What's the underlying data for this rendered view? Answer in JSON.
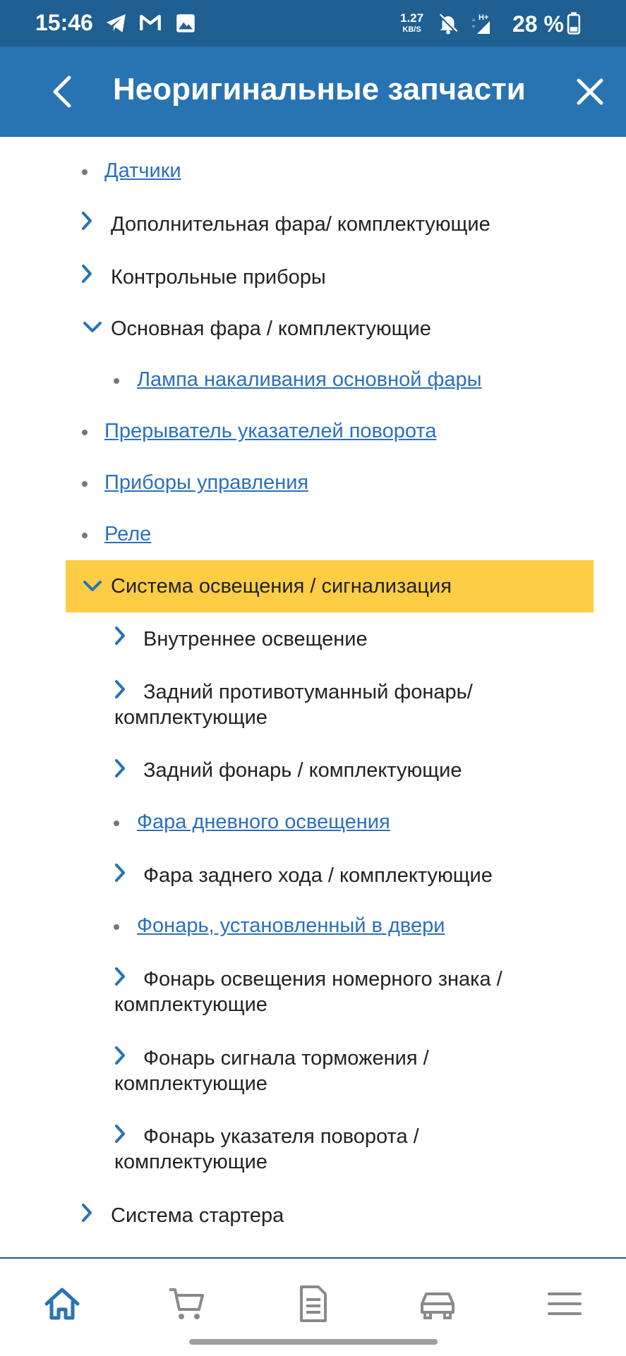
{
  "status_bar": {
    "time": "15:46",
    "net_speed": "1.27",
    "net_unit": "KB/S",
    "network": "H+",
    "battery": "28 %",
    "icons": [
      "telegram-icon",
      "gmail-icon",
      "gallery-icon",
      "bell-off-icon",
      "signal-icon",
      "battery-icon"
    ]
  },
  "header": {
    "title": "Неоригинальные запчасти",
    "back_icon": "back-arrow-icon",
    "close_icon": "close-icon"
  },
  "list": {
    "items": [
      {
        "label": "Датчики",
        "type": "link"
      },
      {
        "label": "Дополнительная фара/ комплектующие",
        "type": "collapsed"
      },
      {
        "label": "Контрольные приборы",
        "type": "collapsed"
      },
      {
        "label": "Основная фара / комплектующие",
        "type": "expanded"
      },
      {
        "label": "Лампа накаливания основной фары",
        "type": "link"
      },
      {
        "label": "Прерыватель указателей поворота",
        "type": "link"
      },
      {
        "label": "Приборы управления",
        "type": "link"
      },
      {
        "label": "Реле",
        "type": "link"
      },
      {
        "label": "Система освещения / сигнализация",
        "type": "expanded-selected"
      },
      {
        "label": "Внутреннее освещение",
        "type": "collapsed"
      },
      {
        "label": "Задний противотуманный фонарь/ комплектующие",
        "type": "collapsed"
      },
      {
        "label": "Задний фонарь / комплектующие",
        "type": "collapsed"
      },
      {
        "label": "Фара дневного освещения",
        "type": "link"
      },
      {
        "label": "Фара заднего хода / комплектующие",
        "type": "collapsed"
      },
      {
        "label": "Фонарь, установленный в двери",
        "type": "link"
      },
      {
        "label": "Фонарь освещения номерного знака / комплектующие",
        "type": "collapsed"
      },
      {
        "label": "Фонарь сигнала торможения / комплектующие",
        "type": "collapsed"
      },
      {
        "label": "Фонарь указателя поворота / комплектующие",
        "type": "collapsed"
      },
      {
        "label": "Система стартера",
        "type": "collapsed"
      }
    ]
  },
  "bottom_nav": {
    "items": [
      "home-icon",
      "cart-icon",
      "document-icon",
      "car-icon",
      "menu-icon"
    ],
    "active": "home-icon"
  },
  "colors": {
    "header": "#2873b2",
    "status_bar": "#1f5f91",
    "highlight": "#fccd45",
    "link": "#2c6fbf",
    "chevron": "#2873b2"
  }
}
